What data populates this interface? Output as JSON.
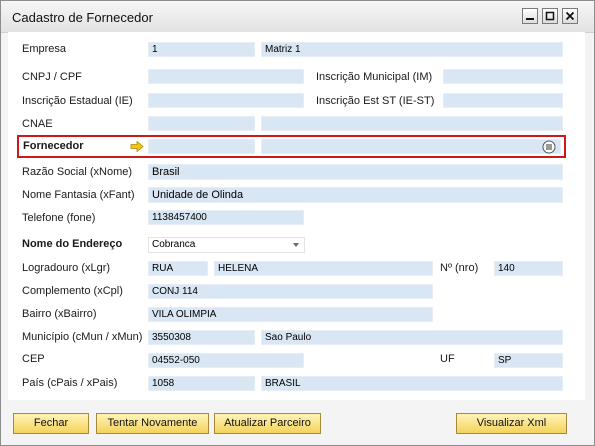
{
  "window": {
    "title": "Cadastro de Fornecedor"
  },
  "labels": {
    "empresa": "Empresa",
    "cnpj": "CNPJ / CPF",
    "inscricao_municipal": "Inscrição Municipal (IM)",
    "inscricao_estadual": "Inscrição Estadual (IE)",
    "inscricao_est_st": "Inscrição Est ST (IE-ST)",
    "cnae": "CNAE",
    "fornecedor": "Fornecedor",
    "razao_social": "Razão Social (xNome)",
    "nome_fantasia": "Nome Fantasia (xFant)",
    "telefone": "Telefone (fone)",
    "nome_endereco": "Nome do Endereço",
    "logradouro": "Logradouro (xLgr)",
    "numero": "Nº (nro)",
    "complemento": "Complemento (xCpl)",
    "bairro": "Bairro (xBairro)",
    "municipio": "Município (cMun / xMun)",
    "cep": "CEP",
    "uf": "UF",
    "pais": "País (cPais / xPais)"
  },
  "values": {
    "empresa_code": "1",
    "empresa_name": "Matriz 1",
    "razao_social": "Brasil",
    "nome_fantasia": "Unidade de Olinda",
    "telefone": "1138457400",
    "nome_endereco": "Cobranca",
    "logradouro_tipo": "RUA",
    "logradouro": "HELENA",
    "numero": "140",
    "complemento": "CONJ 114",
    "bairro": "VILA OLIMPIA",
    "municipio_code": "3550308",
    "municipio_name": "Sao Paulo",
    "cep": "04552-050",
    "uf": "SP",
    "pais_code": "1058",
    "pais_name": "BRASIL"
  },
  "buttons": {
    "fechar": "Fechar",
    "tentar": "Tentar Novamente",
    "atualizar": "Atualizar Parceiro",
    "visualizar": "Visualizar Xml"
  },
  "colors": {
    "highlight": "#cc1a1a",
    "field_bg": "#d9e6f3",
    "button_bg": "#f4d35c"
  }
}
